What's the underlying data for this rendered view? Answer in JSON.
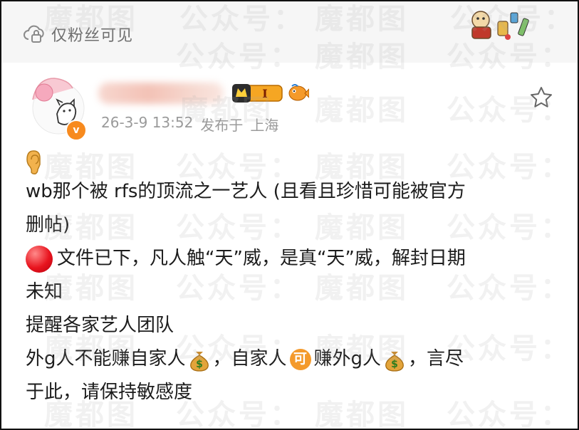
{
  "header": {
    "privacy_label": "仅粉丝可见",
    "privacy_icon": "cloud-lock-icon"
  },
  "post": {
    "author_name_hidden": true,
    "verified_badge": "v",
    "level_badge": "I",
    "date": "26-3-9 13:52",
    "publish_prefix": "发布于",
    "location": "上海",
    "lines": [
      "wb那个被 rfs的顶流之一艺人 (且看且珍惜可能被官方",
      "删帖)",
      "文件已下，凡人触“天”威，是真“天”威，解封日期",
      "未知",
      "提醒各家艺人团队",
      "外g人不能赚自家人",
      "，自家人",
      "赚外g人",
      "，言尽",
      "于此，请保持敏感度"
    ],
    "ke_badge": "可"
  },
  "watermark": {
    "text_a": "魔都图",
    "text_b": "公众号："
  },
  "colors": {
    "accent": "#f78a1e",
    "meta_gray": "#9a9a9a",
    "text": "#1c1c1c"
  }
}
